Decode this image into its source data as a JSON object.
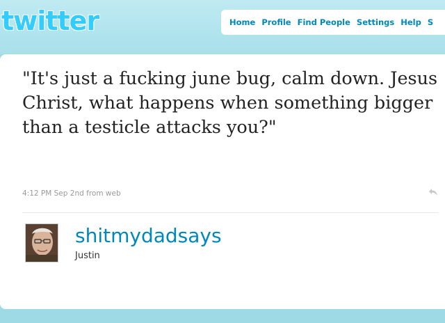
{
  "header": {
    "logo_text": "twitter",
    "nav": [
      "Home",
      "Profile",
      "Find People",
      "Settings",
      "Help",
      "S"
    ]
  },
  "tweet": {
    "text": "\"It's just a fucking june bug, calm down. Jesus Christ, what happens when something bigger than a testicle attacks you?\"",
    "time": "4:12 PM Sep 2nd",
    "from_label": "from",
    "source": "web"
  },
  "author": {
    "screen_name": "shitmydadsays",
    "full_name": "Justin"
  },
  "icons": {
    "reply": "reply-icon",
    "avatar": "avatar-photo"
  },
  "colors": {
    "background": "#9ed9e6",
    "link": "#0088bb",
    "logo": "#33ccff"
  }
}
